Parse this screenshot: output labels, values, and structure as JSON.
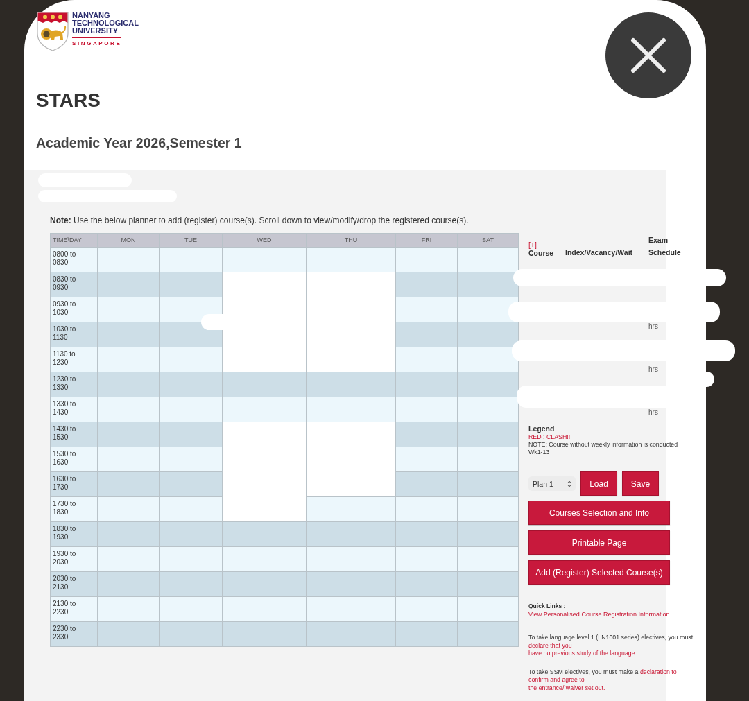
{
  "logo": {
    "lines": [
      "NANYANG",
      "TECHNOLOGICAL",
      "UNIVERSITY"
    ],
    "tagline": "SINGAPORE"
  },
  "title": "STARS",
  "subtitle": "Academic Year 2026,Semester 1",
  "note": "**Note:** Use the below planner to add (register) course(s). Scroll down to view/modify/drop the registered course(s).",
  "timetable": {
    "columns": [
      "TIME\\DAY",
      "MON",
      "TUE",
      "WED",
      "THU",
      "FRI",
      "SAT"
    ],
    "rows": [
      {
        "time": "0800 to 0830",
        "cells": [
          {
            "blank": false
          },
          {
            "blank": false
          },
          {
            "blank": false
          },
          {
            "blank": false
          },
          {
            "blank": false
          },
          {
            "blank": false
          }
        ]
      },
      {
        "time": "0830 to 0930",
        "cells": [
          {
            "blank": false
          },
          {
            "blank": false
          },
          {
            "blank": true
          },
          {
            "blank": true
          },
          {
            "blank": false
          },
          {
            "blank": false
          }
        ]
      },
      {
        "time": "0930 to 1030",
        "cells": [
          {
            "blank": false
          },
          {
            "blank": false
          },
          {
            "blank": true
          },
          {
            "blank": true
          },
          {
            "blank": false
          },
          {
            "blank": false
          }
        ]
      },
      {
        "time": "1030 to 1130",
        "cells": [
          {
            "blank": false
          },
          {
            "blank": false
          },
          {
            "blank": true
          },
          {
            "blank": true
          },
          {
            "blank": false
          },
          {
            "blank": false
          }
        ]
      },
      {
        "time": "1130 to 1230",
        "cells": [
          {
            "blank": false
          },
          {
            "blank": false
          },
          {
            "blank": true
          },
          {
            "blank": true
          },
          {
            "blank": false
          },
          {
            "blank": false
          }
        ]
      },
      {
        "time": "1230 to 1330",
        "cells": [
          {
            "blank": false
          },
          {
            "blank": false
          },
          {
            "blank": false
          },
          {
            "blank": false
          },
          {
            "blank": false
          },
          {
            "blank": false
          }
        ]
      },
      {
        "time": "1330 to 1430",
        "cells": [
          {
            "blank": false
          },
          {
            "blank": false
          },
          {
            "blank": false
          },
          {
            "blank": false
          },
          {
            "blank": false
          },
          {
            "blank": false
          }
        ]
      },
      {
        "time": "1430 to 1530",
        "cells": [
          {
            "blank": false
          },
          {
            "blank": false
          },
          {
            "blank": true
          },
          {
            "blank": true
          },
          {
            "blank": false
          },
          {
            "blank": false
          }
        ]
      },
      {
        "time": "1530 to 1630",
        "cells": [
          {
            "blank": false
          },
          {
            "blank": false
          },
          {
            "blank": true
          },
          {
            "blank": true
          },
          {
            "blank": false
          },
          {
            "blank": false
          }
        ]
      },
      {
        "time": "1630 to 1730",
        "cells": [
          {
            "blank": false
          },
          {
            "blank": false
          },
          {
            "blank": true
          },
          {
            "blank": true
          },
          {
            "blank": false
          },
          {
            "blank": false
          }
        ]
      },
      {
        "time": "1730 to 1830",
        "cells": [
          {
            "blank": false
          },
          {
            "blank": false
          },
          {
            "blank": true
          },
          {
            "blank": false
          },
          {
            "blank": false
          },
          {
            "blank": false
          }
        ]
      },
      {
        "time": "1830 to 1930",
        "cells": [
          {
            "blank": false
          },
          {
            "blank": false
          },
          {
            "blank": false
          },
          {
            "blank": false
          },
          {
            "blank": false
          },
          {
            "blank": false
          }
        ]
      },
      {
        "time": "1930 to 2030",
        "cells": [
          {
            "blank": false
          },
          {
            "blank": false
          },
          {
            "blank": false
          },
          {
            "blank": false
          },
          {
            "blank": false
          },
          {
            "blank": false
          }
        ]
      },
      {
        "time": "2030 to 2130",
        "cells": [
          {
            "blank": false
          },
          {
            "blank": false
          },
          {
            "blank": false
          },
          {
            "blank": false
          },
          {
            "blank": false
          },
          {
            "blank": false
          }
        ]
      },
      {
        "time": "2130 to 2230",
        "cells": [
          {
            "blank": false
          },
          {
            "blank": false
          },
          {
            "blank": false
          },
          {
            "blank": false
          },
          {
            "blank": false
          },
          {
            "blank": false
          }
        ]
      },
      {
        "time": "2230 to 2330",
        "cells": [
          {
            "blank": false
          },
          {
            "blank": false
          },
          {
            "blank": false
          },
          {
            "blank": false
          },
          {
            "blank": false
          },
          {
            "blank": false
          }
        ]
      }
    ]
  },
  "registered_courses": {
    "add_link": "[+]",
    "columns": [
      "Course",
      "Index/Vacancy/Wait",
      "Exam Schedule"
    ],
    "exam_schedule_fragments": [
      "hrs",
      "hrs",
      "hrs"
    ]
  },
  "legend": {
    "title": "Legend",
    "clash": "RED : CLASH!!",
    "note": "NOTE: Course without weekly information is conducted Wk1-13"
  },
  "plan_select": {
    "value": "Plan 1"
  },
  "plan_buttons": [
    "Load",
    "Save"
  ],
  "action_buttons": [
    "Courses Selection and Info",
    "Printable Page",
    "Add (Register) Selected Course(s)"
  ],
  "quick_links": {
    "title": "Quick Links :",
    "links": [
      "View Personalised Course Registration Information"
    ]
  },
  "notices": [
    {
      "text": "To take language level 1 (LN1001 series) electives, you must",
      "links": [
        "declare that you",
        "have no previous study of the language."
      ]
    },
    {
      "text": "To take SSM electives, you must make a",
      "links": [
        "declaration to",
        "confirm and agree to",
        "the entrance/ waiver set out."
      ]
    }
  ]
}
